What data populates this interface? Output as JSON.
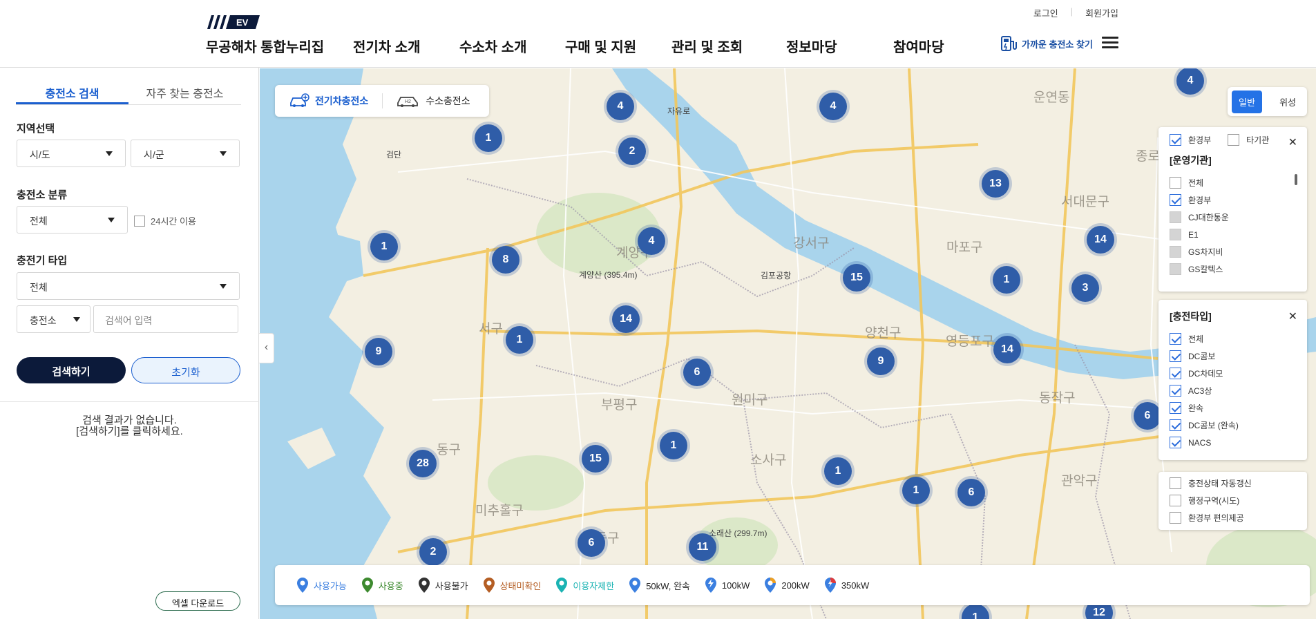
{
  "header": {
    "logo_badge": "EV",
    "site_title": "무공해차 통합누리집",
    "nav": [
      "전기차 소개",
      "수소차 소개",
      "구매 및 지원",
      "관리 및 조회",
      "정보마당",
      "참여마당"
    ],
    "login": "로그인",
    "signup": "회원가입",
    "nearby": "가까운 충전소 찾기"
  },
  "sidebar": {
    "tabs": [
      "충전소 검색",
      "자주 찾는 충전소"
    ],
    "region_label": "지역선택",
    "sido": "시/도",
    "sigun": "시/군",
    "category_label": "충전소 분류",
    "category_value": "전체",
    "open24": "24시간 이용",
    "charger_type_label": "충전기 타입",
    "charger_type_value": "전체",
    "search_target": "충전소",
    "search_placeholder": "검색어 입력",
    "search_button": "검색하기",
    "reset_button": "초기화",
    "no_result_line1": "검색 결과가 없습니다.",
    "no_result_line2": "[검색하기]를 클릭하세요.",
    "excel_button": "엑셀 다운로드"
  },
  "map": {
    "type_options": [
      "전기차충전소",
      "수소충전소"
    ],
    "view": [
      "일반",
      "위성"
    ],
    "clusters": [
      {
        "n": "4"
      },
      {
        "n": "1"
      },
      {
        "n": "2"
      },
      {
        "n": "4"
      },
      {
        "n": "13"
      },
      {
        "n": "4"
      },
      {
        "n": "1"
      },
      {
        "n": "4"
      },
      {
        "n": "8"
      },
      {
        "n": "15"
      },
      {
        "n": "1"
      },
      {
        "n": "14"
      },
      {
        "n": "3"
      },
      {
        "n": "14"
      },
      {
        "n": "1"
      },
      {
        "n": "9"
      },
      {
        "n": "6"
      },
      {
        "n": "9"
      },
      {
        "n": "14"
      },
      {
        "n": "1"
      },
      {
        "n": "15"
      },
      {
        "n": "28"
      },
      {
        "n": "1"
      },
      {
        "n": "1"
      },
      {
        "n": "6"
      },
      {
        "n": "2"
      },
      {
        "n": "6"
      },
      {
        "n": "11"
      },
      {
        "n": "6"
      },
      {
        "n": "12"
      },
      {
        "n": "1"
      }
    ],
    "places": [
      "운연동",
      "자유로",
      "검단",
      "종로구",
      "서대문구",
      "강서구",
      "계양구",
      "서구",
      "마포구",
      "양천구",
      "영등포구",
      "부평구",
      "원미구",
      "소사구",
      "동구",
      "미추홀구",
      "남동구",
      "관악구",
      "동작구",
      "김포공항",
      "계양산 (395.4m)",
      "소래산 (299.7m)"
    ],
    "operator_panel": {
      "top_options": [
        {
          "label": "환경부",
          "checked": true
        },
        {
          "label": "타기관",
          "checked": false
        }
      ],
      "title": "[운영기관]",
      "items": [
        {
          "label": "전체",
          "state": "off"
        },
        {
          "label": "환경부",
          "state": "on"
        },
        {
          "label": "CJ대한통운",
          "state": "dis"
        },
        {
          "label": "E1",
          "state": "dis"
        },
        {
          "label": "GS차지비",
          "state": "dis"
        },
        {
          "label": "GS칼텍스",
          "state": "dis"
        }
      ]
    },
    "charger_panel": {
      "title": "[충전타입]",
      "items": [
        "전체",
        "DC콤보",
        "DC차데모",
        "AC3상",
        "완속",
        "DC콤보 (완속)",
        "NACS"
      ]
    },
    "extra_panel": {
      "items": [
        "충전상태 자동갱신",
        "행정구역(시도)",
        "환경부 편의제공"
      ]
    },
    "legend": [
      {
        "label": "사용가능",
        "color": "#3b7fe0"
      },
      {
        "label": "사용중",
        "color": "#3d8a2f"
      },
      {
        "label": "사용불가",
        "color": "#333333"
      },
      {
        "label": "상태미확인",
        "color": "#b45d23"
      },
      {
        "label": "이용자제한",
        "color": "#1bb3b3"
      },
      {
        "label": "50kW, 완속",
        "color": "#3b7fe0"
      },
      {
        "label": "100kW",
        "color": "#3b7fe0"
      },
      {
        "label": "200kW",
        "color": "#f0a020"
      },
      {
        "label": "350kW",
        "color": "#e03b3b"
      }
    ]
  }
}
